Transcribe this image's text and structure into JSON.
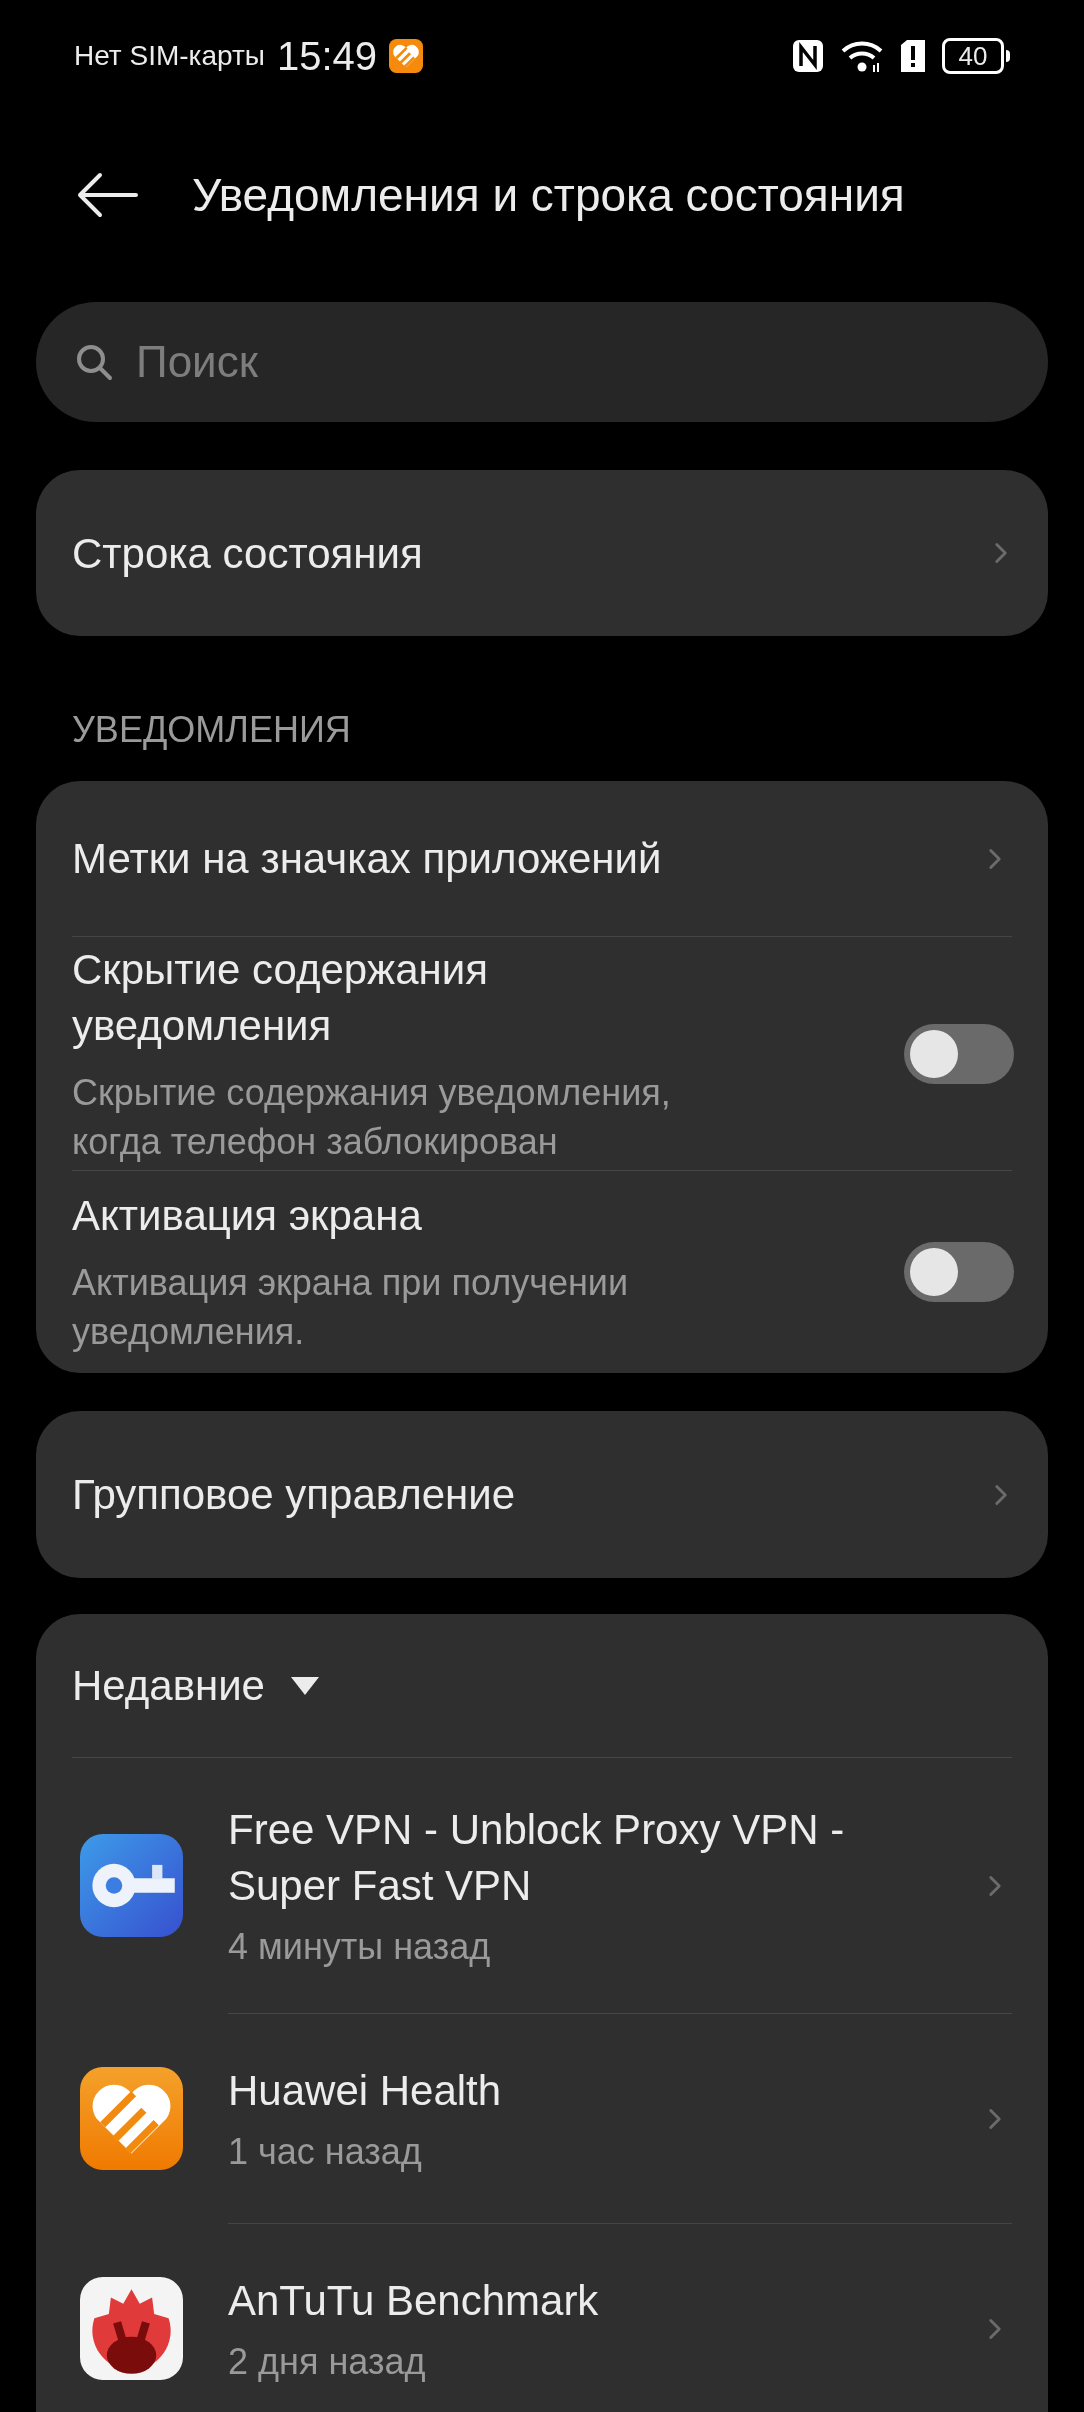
{
  "status_bar": {
    "carrier": "Нет SIM-карты",
    "time": "15:49",
    "battery": "40"
  },
  "header": {
    "title": "Уведомления и строка состояния"
  },
  "search": {
    "placeholder": "Поиск"
  },
  "status_bar_settings": {
    "label": "Строка состояния"
  },
  "notifications": {
    "heading": "УВЕДОМЛЕНИЯ",
    "items": [
      {
        "kind": "link",
        "title": "Метки на значках приложений"
      },
      {
        "kind": "toggle",
        "title": "Скрытие содержания уведомления",
        "subtitle": "Скрытие содержания уведомления, когда телефон заблокирован",
        "on": false
      },
      {
        "kind": "toggle",
        "title": "Активация экрана",
        "subtitle": "Активация экрана при получении уведомления.",
        "on": false
      }
    ]
  },
  "group_management": {
    "label": "Групповое управление"
  },
  "recent": {
    "label": "Недавние",
    "apps": [
      {
        "name": "Free VPN - Unblock Proxy VPN - Super Fast VPN",
        "time": "4 минуты назад"
      },
      {
        "name": "Huawei Health",
        "time": "1 час назад"
      },
      {
        "name": "AnTuTu Benchmark",
        "time": "2 дня назад"
      }
    ]
  }
}
